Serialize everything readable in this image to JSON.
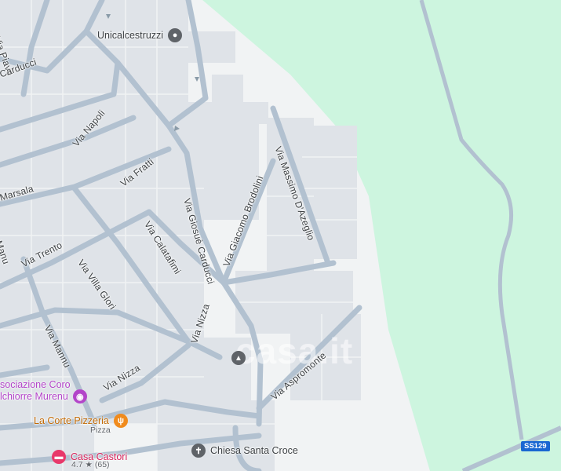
{
  "map": {
    "colors": {
      "park": "#cdf5df",
      "land": "#f1f3f4",
      "block": "#dfe3e8",
      "road": "#b2c1d0",
      "main_road": "#a5b5c6",
      "text": "#3c4043"
    },
    "streets": {
      "via_piave": "Via Piave",
      "via_carducci_nw": "Carducci",
      "via_napoli": "Via Napoli",
      "via_fratti": "Via Fratti",
      "via_marsala": "Marsala",
      "via_trento": "Via Trento",
      "via_manu_left": "Manu",
      "via_calatafimi": "Via Calatafimi",
      "via_giosue_carducci": "Via Giosuè Carducci",
      "via_giacomo_brodolini": "Via Giacomo Brodolini",
      "via_massimo_dazeglio": "Via Massimo D'Azeglio",
      "via_villa_glori": "Via Villa Glori",
      "via_nizza_main": "Via Nizza",
      "via_mannu": "Via Mannu",
      "via_nizza_small": "Via Nizza",
      "via_aspromonte": "Via Aspromonte",
      "via_top_left": "D"
    },
    "pois": {
      "unicalcestruzzi": {
        "name": "Unicalcestruzzi",
        "icon": "pin-icon",
        "color": "#5f6368"
      },
      "associazione": {
        "line1": "sociazione Coro",
        "line2": "lchiorre Murenu",
        "icon": "camera-icon",
        "color": "#b345c9"
      },
      "la_corte": {
        "name": "La Corte Pizzeria",
        "category": "Pizza",
        "icon": "fork-knife-icon",
        "color": "#f08b1d"
      },
      "casa_castori": {
        "name": "Casa Castori",
        "rating": "4.7",
        "star": "★",
        "reviews": "(65)",
        "icon": "bed-icon",
        "color": "#e8386a"
      },
      "chiesa": {
        "name": "Chiesa Santa Croce",
        "icon": "cross-icon",
        "color": "#5f6368"
      },
      "school": {
        "icon": "school-icon",
        "color": "#5f6368"
      }
    },
    "road_shield": "SS129",
    "watermark": "casa.it"
  }
}
